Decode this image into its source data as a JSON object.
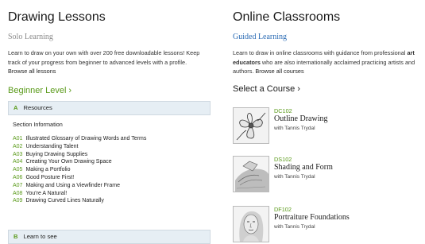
{
  "left": {
    "title": "Drawing Lessons",
    "subtitle": "Solo Learning",
    "description": "Learn to draw on your own with over 200 free downloadable lessons! Keep track of your progress from beginner to advanced levels with a profile.",
    "browse_link": "Browse all lessons",
    "level_label": "Beginner Level",
    "level_chevron": "›",
    "section_a": {
      "letter": "A",
      "label": "Resources"
    },
    "section_info": "Section Information",
    "lessons": [
      {
        "code": "A01",
        "title": "Illustrated Glossary of Drawing Words and Terms"
      },
      {
        "code": "A02",
        "title": "Understanding Talent"
      },
      {
        "code": "A03",
        "title": "Buying Drawing Supplies"
      },
      {
        "code": "A04",
        "title": "Creating Your Own Drawing Space"
      },
      {
        "code": "A05",
        "title": "Making a Portfolio"
      },
      {
        "code": "A06",
        "title": "Good Posture First!"
      },
      {
        "code": "A07",
        "title": "Making and Using a Viewfinder Frame"
      },
      {
        "code": "A08",
        "title": "You're A Natural!"
      },
      {
        "code": "A09",
        "title": "Drawing Curved Lines Naturally"
      }
    ],
    "section_b": {
      "letter": "B",
      "label": "Learn to see"
    }
  },
  "right": {
    "title": "Online Classrooms",
    "subtitle": "Guided Learning",
    "description_part1": "Learn to draw in online classrooms with guidance from professional ",
    "description_bold": "art educators",
    "description_part2": " who are also internationally acclaimed practicing artists and authors.",
    "browse_link": "Browse all courses",
    "select_label": "Select a Course",
    "select_chevron": "›",
    "courses": [
      {
        "code": "DC102",
        "title": "Outline Drawing",
        "instructor": "with Tannis Trydal",
        "thumb_icon": "flower-sketch-icon"
      },
      {
        "code": "DS102",
        "title": "Shading and Form",
        "instructor": "with Tannis Trydal",
        "thumb_icon": "shaded-form-sketch-icon"
      },
      {
        "code": "DF102",
        "title": "Portraiture Foundations",
        "instructor": "with Tannis Trydal",
        "thumb_icon": "portrait-sketch-icon"
      }
    ]
  },
  "colors": {
    "accent_green": "#5a9a1a",
    "link_blue": "#2c6cb5",
    "section_bar_bg": "#e6eef4"
  }
}
